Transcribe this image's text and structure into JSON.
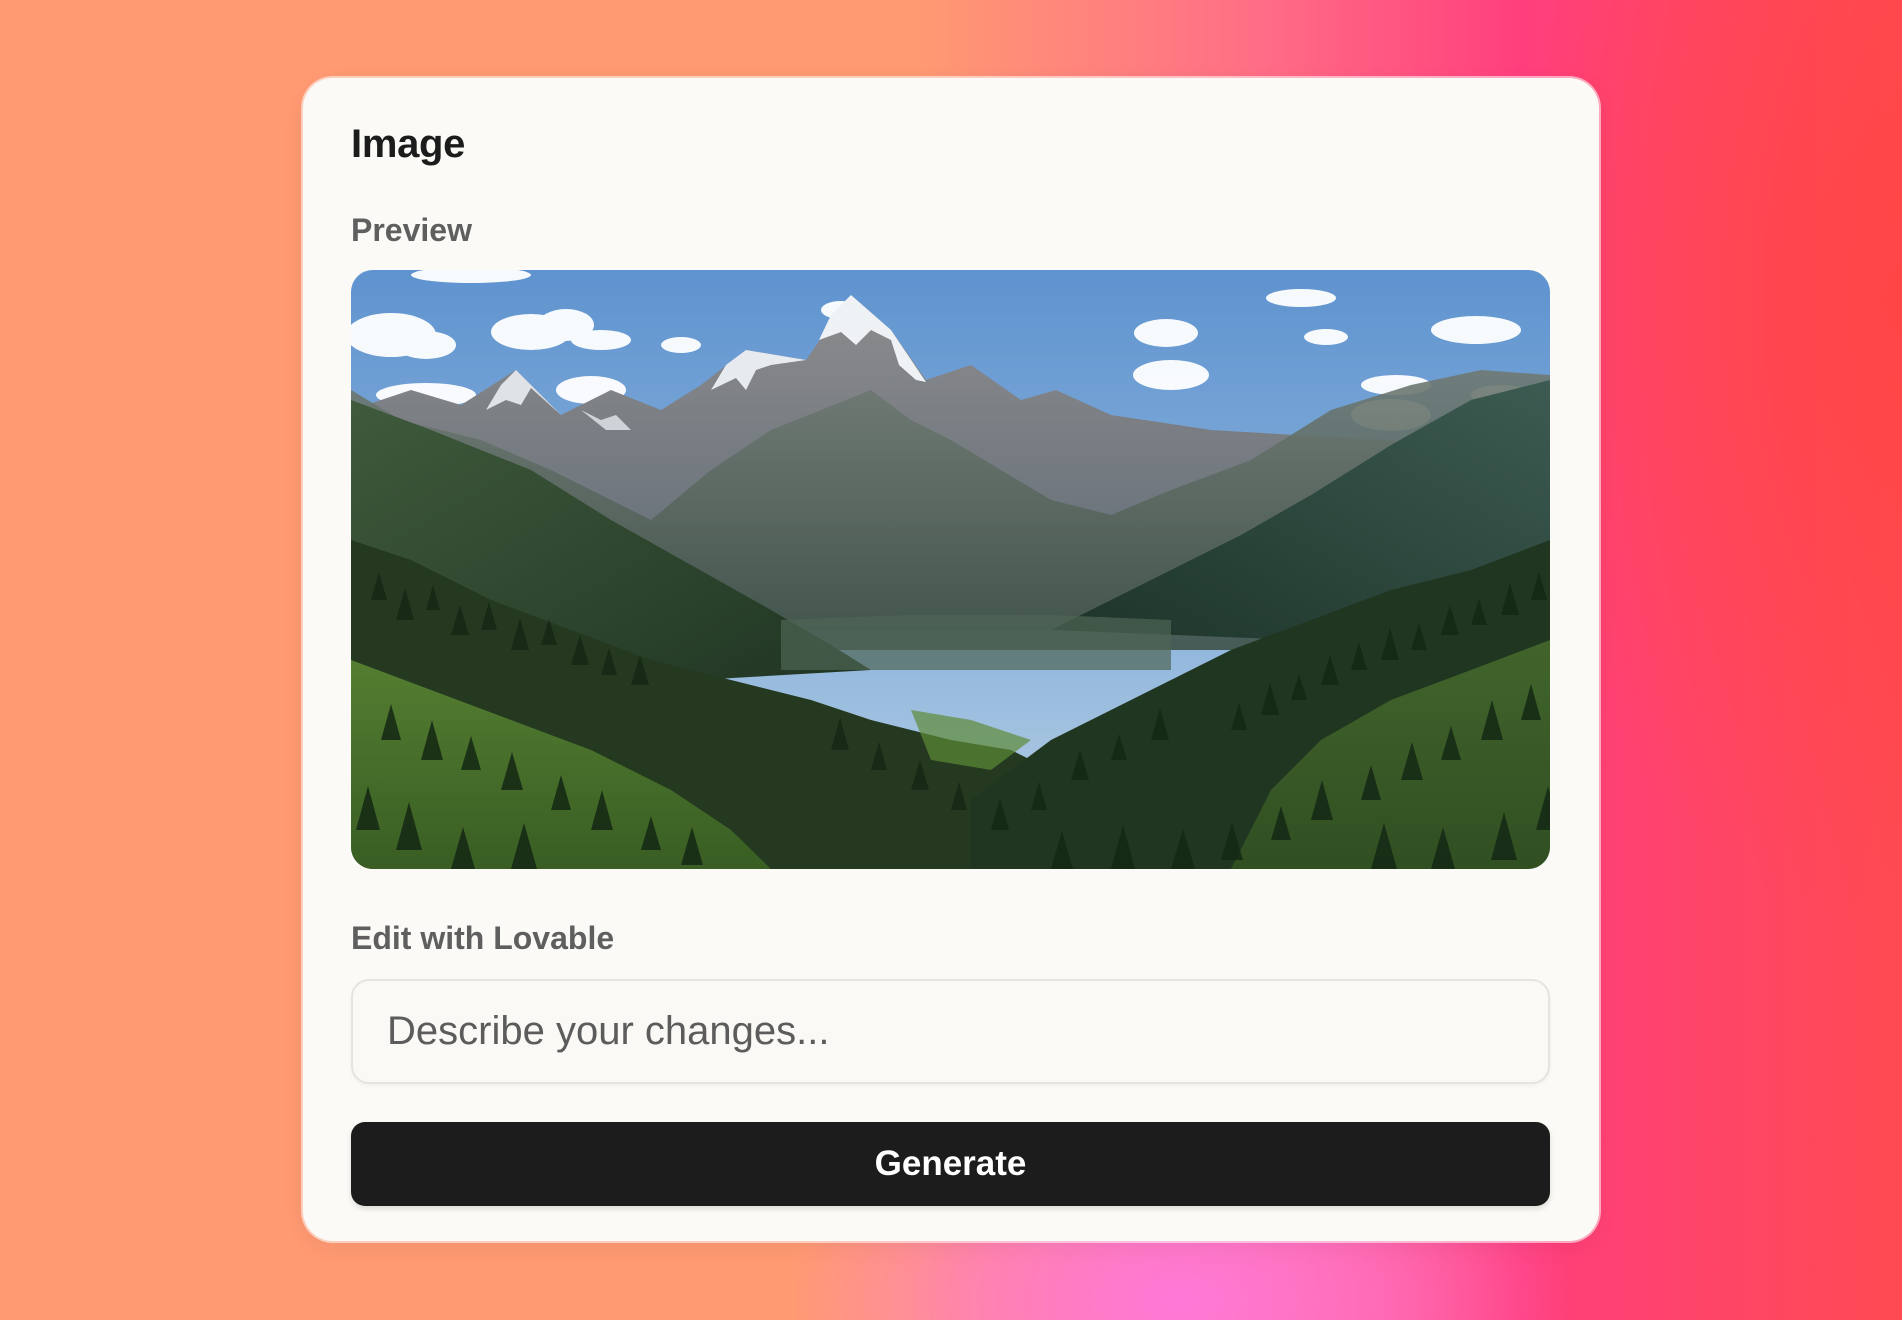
{
  "card": {
    "title": "Image",
    "preview_label": "Preview",
    "edit_label": "Edit with Lovable"
  },
  "preview_image": {
    "alt": "Mountain valley landscape"
  },
  "prompt": {
    "value": "",
    "placeholder": "Describe your changes..."
  },
  "generate_button": {
    "label": "Generate"
  },
  "colors": {
    "card_background": "#fbfaf6",
    "button_background": "#1c1c1c",
    "button_text": "#ffffff",
    "label_text": "#5f5f5f",
    "title_text": "#1c1c1c"
  }
}
